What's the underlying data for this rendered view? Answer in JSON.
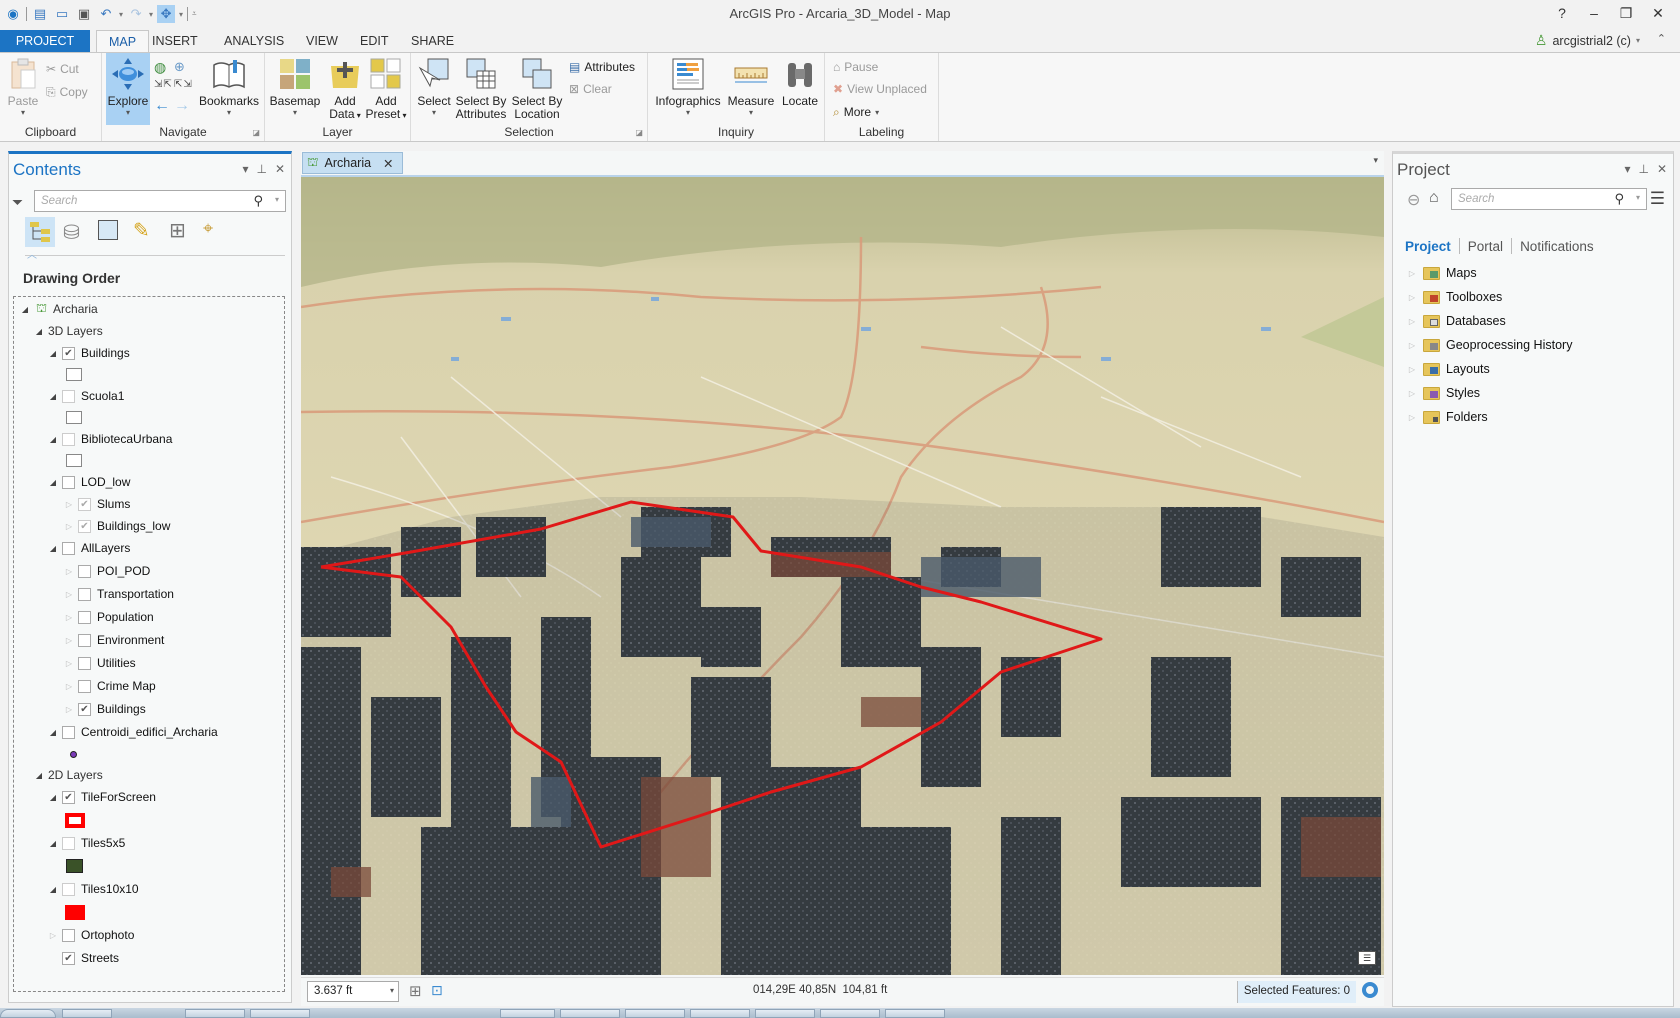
{
  "window": {
    "title": "ArcGIS Pro - Arcaria_3D_Model - Map",
    "controls": {
      "help": "?",
      "minimize": "‒",
      "restore": "❐",
      "close": "✕"
    }
  },
  "quick_access": {
    "icons": [
      "arcgis-logo-icon",
      "new-project-icon",
      "open-project-icon",
      "save-project-icon",
      "undo-icon",
      "redo-icon",
      "explore-tool-icon",
      "customize-qat-icon"
    ]
  },
  "ribbon_tabs": [
    {
      "label": "PROJECT",
      "active": false
    },
    {
      "label": "MAP",
      "active": true
    },
    {
      "label": "INSERT",
      "active": false
    },
    {
      "label": "ANALYSIS",
      "active": false
    },
    {
      "label": "VIEW",
      "active": false
    },
    {
      "label": "EDIT",
      "active": false
    },
    {
      "label": "SHARE",
      "active": false
    }
  ],
  "user": {
    "name": "arcgistrial2 (c)"
  },
  "ribbon": {
    "clipboard": {
      "label": "Clipboard",
      "paste": "Paste",
      "cut": "Cut",
      "copy": "Copy"
    },
    "navigate": {
      "label": "Navigate",
      "explore": "Explore",
      "bookmarks": "Bookmarks"
    },
    "layer": {
      "label": "Layer",
      "basemap": "Basemap",
      "add_data_1": "Add",
      "add_data_2": "Data",
      "add_preset_1": "Add",
      "add_preset_2": "Preset"
    },
    "selection": {
      "label": "Selection",
      "select": "Select",
      "sba_1": "Select By",
      "sba_2": "Attributes",
      "sbl_1": "Select By",
      "sbl_2": "Location",
      "attributes": "Attributes",
      "clear": "Clear"
    },
    "inquiry": {
      "label": "Inquiry",
      "infographics": "Infographics",
      "measure": "Measure",
      "locate": "Locate"
    },
    "labeling": {
      "label": "Labeling",
      "pause": "Pause",
      "view_unplaced": "View Unplaced",
      "more": "More"
    }
  },
  "contents": {
    "title": "Contents",
    "search_placeholder": "Search",
    "section": "Drawing Order",
    "tree": [
      {
        "label": "Archaria",
        "type": "map",
        "expanded": true
      },
      {
        "label": "3D Layers",
        "type": "group-header",
        "expanded": true
      },
      {
        "label": "Buildings",
        "checked": true,
        "expanded": true,
        "symbol": "white-box"
      },
      {
        "label": "Scuola1",
        "checked": false,
        "expanded": true,
        "symbol": "white-box"
      },
      {
        "label": "BibliotecaUrbana",
        "checked": false,
        "expanded": true,
        "symbol": "white-box"
      },
      {
        "label": "LOD_low",
        "checked": false,
        "expanded": true
      },
      {
        "label": "Slums",
        "checked": true,
        "expanded": false,
        "dim": true
      },
      {
        "label": "Buildings_low",
        "checked": true,
        "expanded": false,
        "dim": true
      },
      {
        "label": "AllLayers",
        "checked": false,
        "expanded": true
      },
      {
        "label": "POI_POD",
        "checked": false,
        "expanded": false
      },
      {
        "label": "Transportation",
        "checked": false,
        "expanded": false
      },
      {
        "label": "Population",
        "checked": false,
        "expanded": false
      },
      {
        "label": "Environment",
        "checked": false,
        "expanded": false
      },
      {
        "label": "Utilities",
        "checked": false,
        "expanded": false
      },
      {
        "label": "Crime Map",
        "checked": false,
        "expanded": false
      },
      {
        "label": "Buildings",
        "checked": true,
        "expanded": false
      },
      {
        "label": "Centroidi_edifici_Archaria",
        "checked": false,
        "expanded": true,
        "symbol": "purple-dot"
      },
      {
        "label": "2D Layers",
        "type": "group-header",
        "expanded": true
      },
      {
        "label": "TileForScreen",
        "checked": true,
        "expanded": true,
        "symbol": "red-outline"
      },
      {
        "label": "Tiles5x5",
        "checked": false,
        "expanded": true,
        "symbol": "dark-green-fill"
      },
      {
        "label": "Tiles10x10",
        "checked": false,
        "expanded": true,
        "symbol": "red-fill"
      },
      {
        "label": "Ortophoto",
        "checked": false,
        "expanded": false
      },
      {
        "label": "Streets",
        "checked": true
      }
    ]
  },
  "map_view": {
    "tab_label": "Archaria",
    "scale": "3.637 ft",
    "coordinates": "014,29E 40,85N",
    "elevation": "104,81 ft",
    "selected_features": "Selected Features: 0"
  },
  "project_pane": {
    "title": "Project",
    "search_placeholder": "Search",
    "tabs": [
      {
        "label": "Project",
        "active": true
      },
      {
        "label": "Portal",
        "active": false
      },
      {
        "label": "Notifications",
        "active": false
      }
    ],
    "items": [
      {
        "label": "Maps",
        "icon": "maps-folder-icon"
      },
      {
        "label": "Toolboxes",
        "icon": "toolboxes-folder-icon"
      },
      {
        "label": "Databases",
        "icon": "databases-folder-icon"
      },
      {
        "label": "Geoprocessing History",
        "icon": "geoprocessing-history-icon"
      },
      {
        "label": "Layouts",
        "icon": "layouts-folder-icon"
      },
      {
        "label": "Styles",
        "icon": "styles-folder-icon"
      },
      {
        "label": "Folders",
        "icon": "folders-folder-icon"
      }
    ]
  },
  "colors": {
    "accent": "#1c74c4",
    "route": "#e01818",
    "terrain": "#e6dcb4",
    "selected_tool": "#a9d1f3"
  }
}
